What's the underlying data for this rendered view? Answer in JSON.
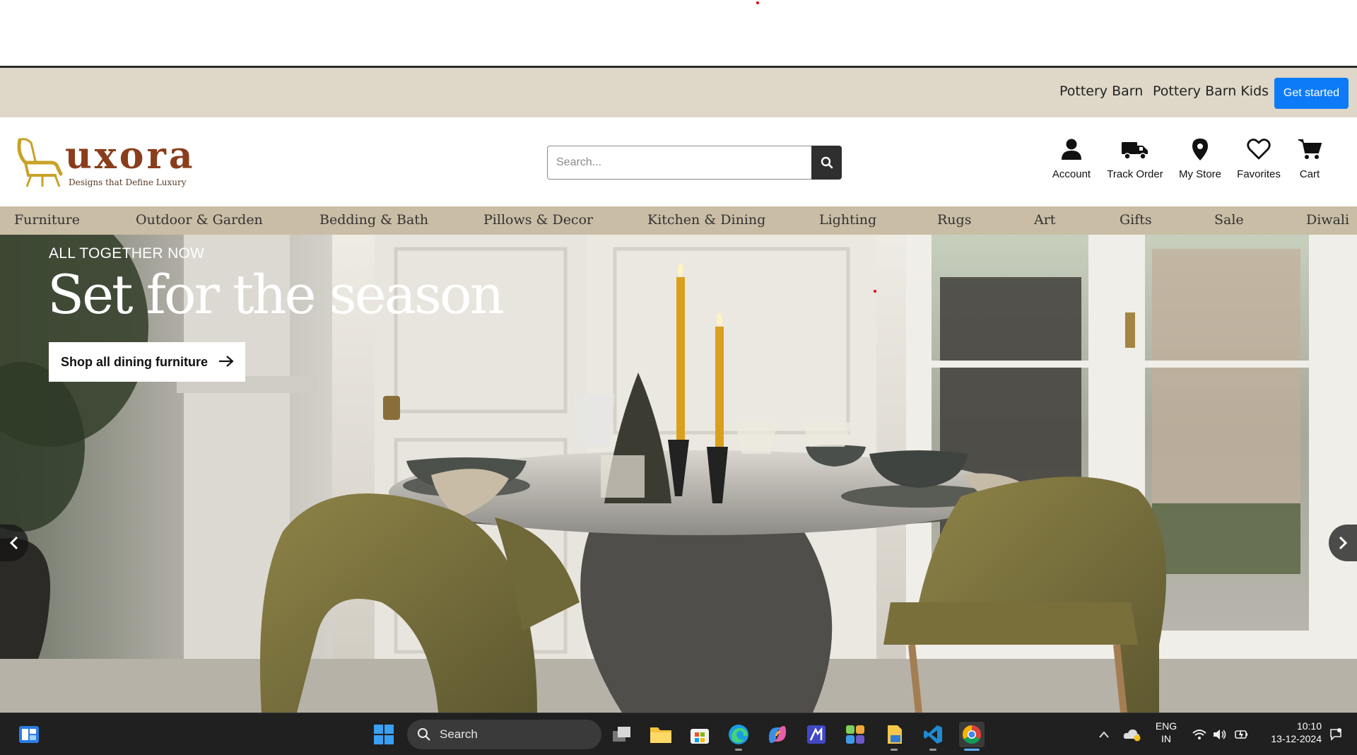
{
  "top_bar": {
    "links": [
      "Pottery Barn",
      "Pottery Barn Kids"
    ],
    "cta_label": "Get started"
  },
  "logo": {
    "wordmark": "uxora",
    "tagline": "Designs that Define Luxury"
  },
  "search": {
    "placeholder": "Search..."
  },
  "utility_nav": [
    {
      "label": "Account",
      "icon": "user-icon"
    },
    {
      "label": "Track Order",
      "icon": "truck-icon"
    },
    {
      "label": "My Store",
      "icon": "location-pin-icon"
    },
    {
      "label": "Favorites",
      "icon": "heart-icon"
    },
    {
      "label": "Cart",
      "icon": "cart-icon"
    }
  ],
  "categories": [
    "Furniture",
    "Outdoor & Garden",
    "Bedding & Bath",
    "Pillows & Decor",
    "Kitchen & Dining",
    "Lighting",
    "Rugs",
    "Art",
    "Gifts",
    "Sale",
    "Diwali"
  ],
  "hero": {
    "eyebrow": "ALL TOGETHER NOW",
    "title": "Set for the season",
    "cta_label": "Shop all dining furniture"
  },
  "taskbar": {
    "search_label": "Search",
    "language": "ENG",
    "region": "IN",
    "time": "10:10",
    "date": "13-12-2024"
  },
  "colors": {
    "promo_bar": "#dfd8c8",
    "category_nav": "#c9bda5",
    "cta_blue": "#0d7bf7",
    "logo_brown": "#8a3d1c"
  }
}
